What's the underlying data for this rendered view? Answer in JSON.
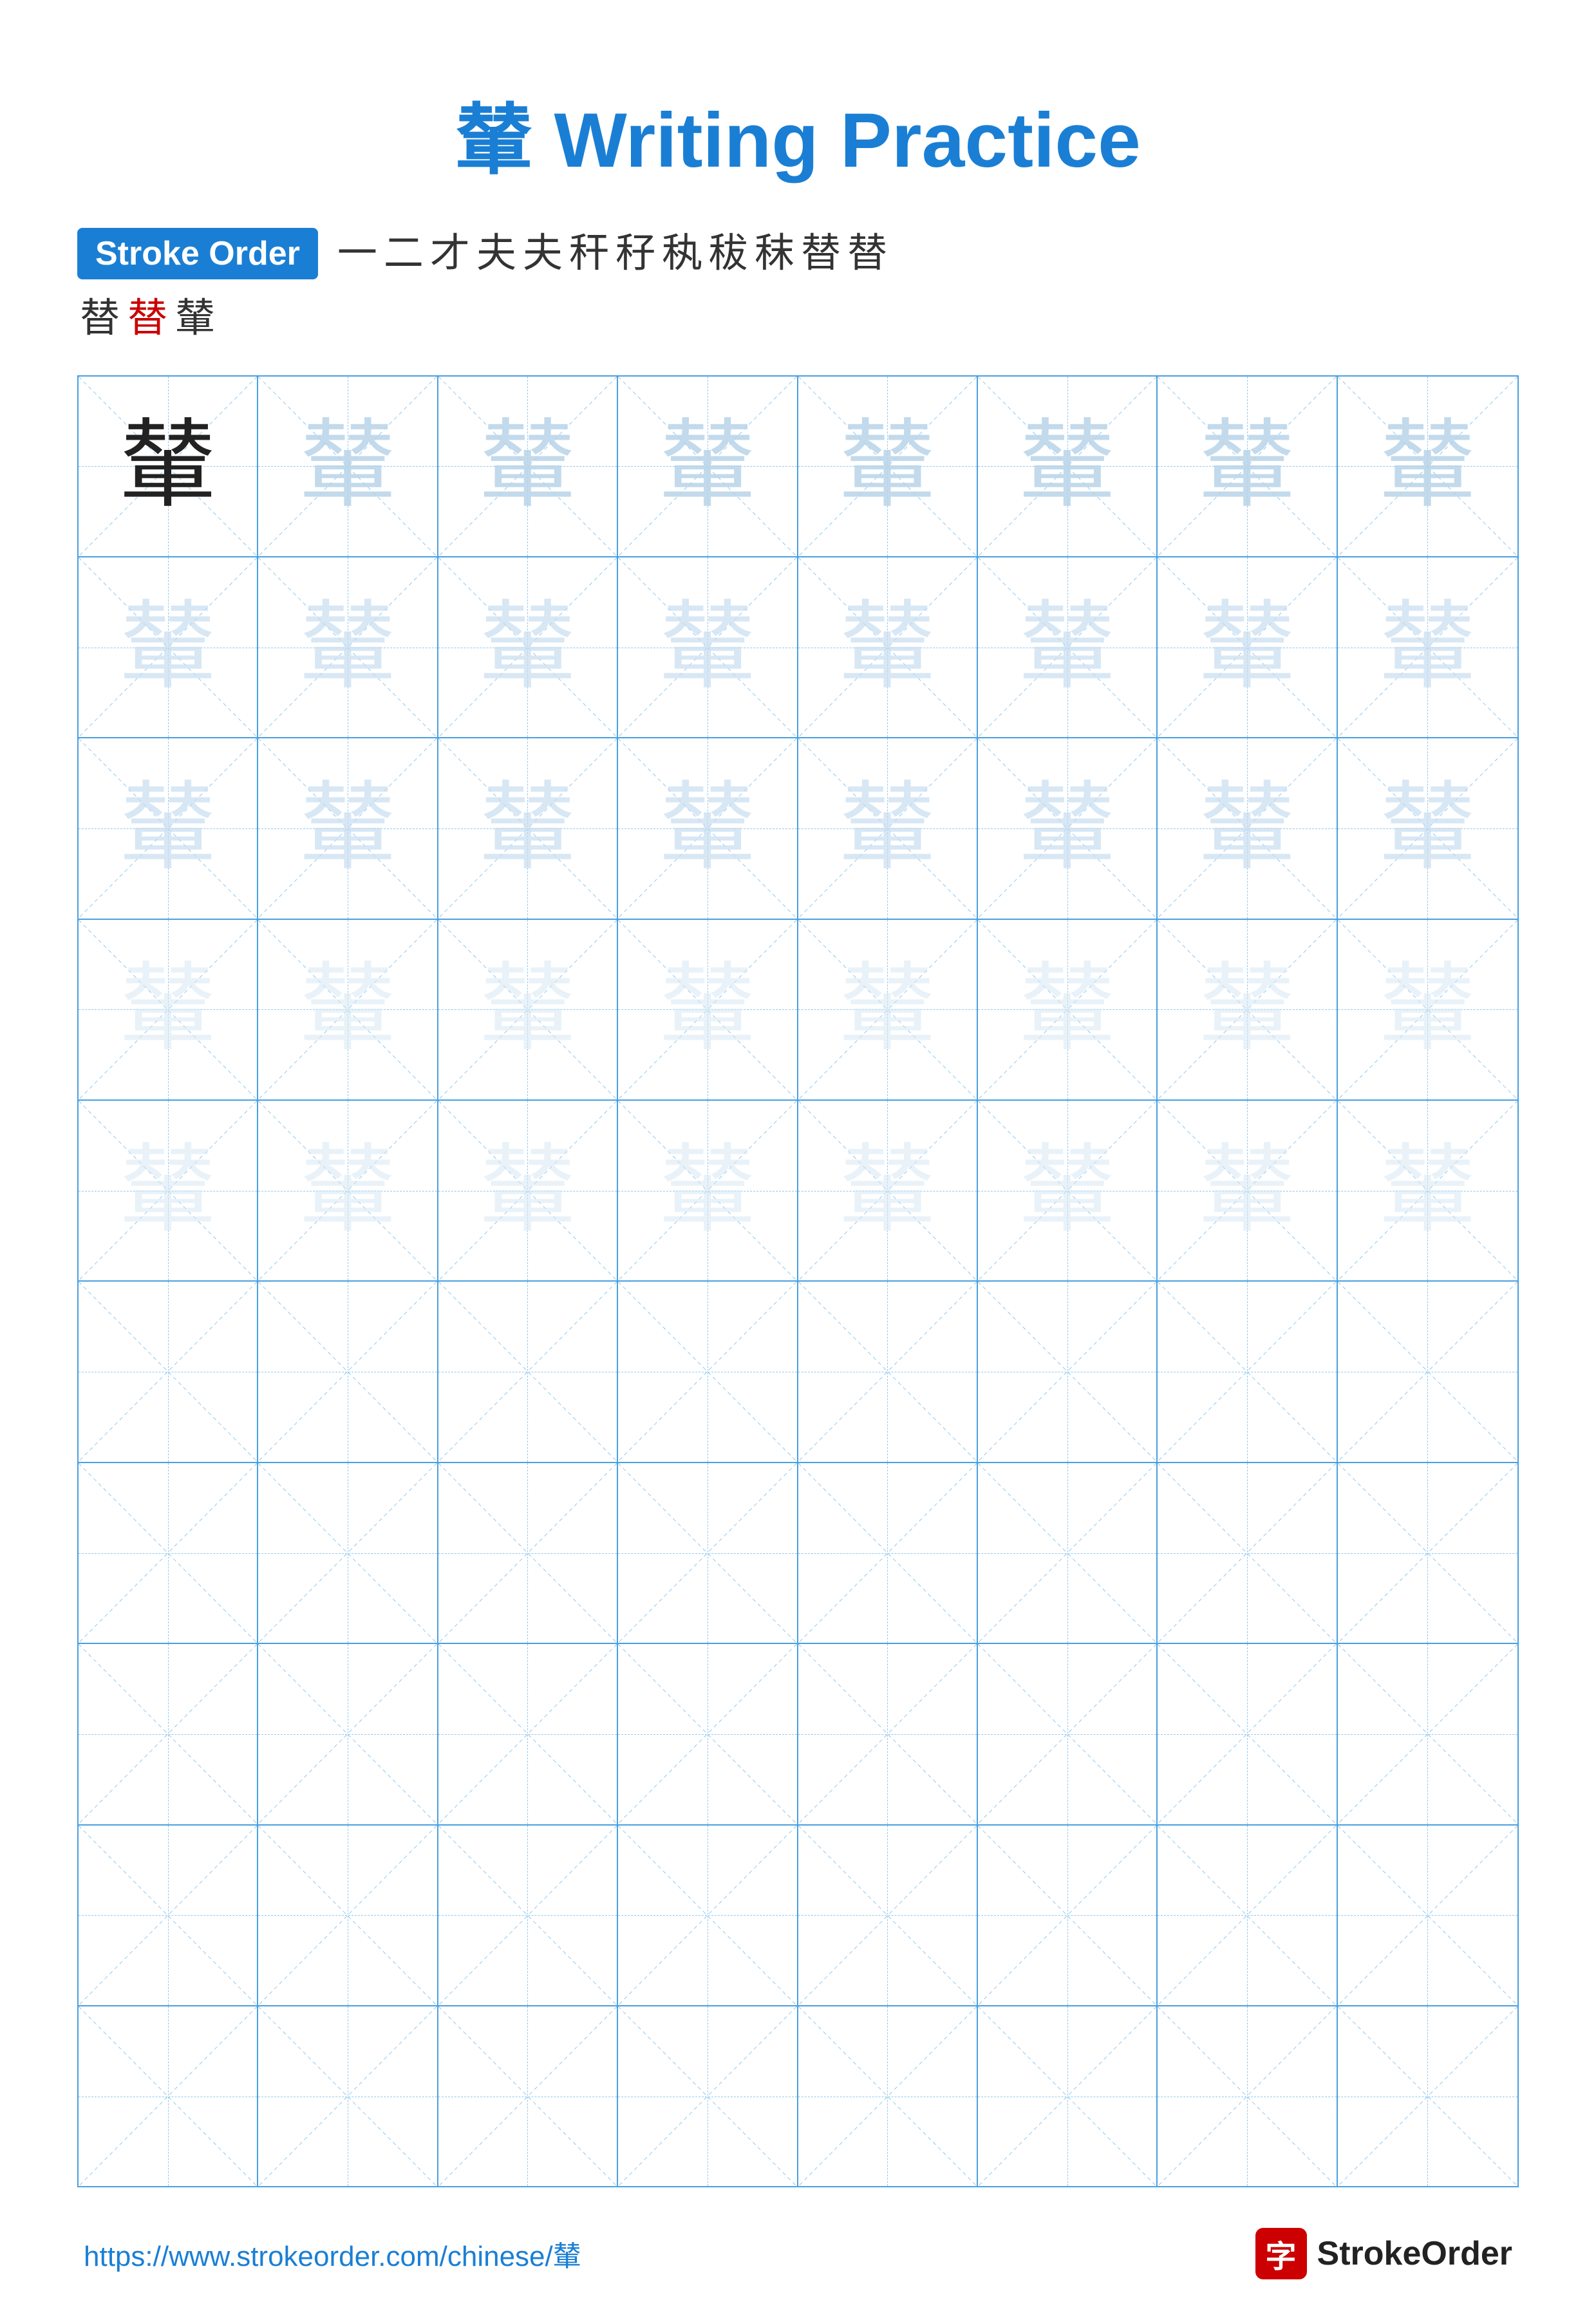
{
  "title": {
    "char": "輦",
    "text": " Writing Practice",
    "full": "輦 Writing Practice"
  },
  "stroke_order": {
    "badge": "Stroke Order",
    "sequence_line1": [
      "一",
      "二",
      "才",
      "夫",
      "夫",
      "秆",
      "秄",
      "秇",
      "秡",
      "秣",
      "替",
      "替"
    ],
    "sequence_line2": [
      "替",
      "替",
      "輦"
    ],
    "red_index_line2": 1
  },
  "grid": {
    "rows": 10,
    "cols": 8,
    "practice_char": "輦",
    "example_rows": 5
  },
  "footer": {
    "url": "https://www.strokeorder.com/chinese/輦",
    "brand_icon": "字",
    "brand_name": "StrokeOrder"
  }
}
